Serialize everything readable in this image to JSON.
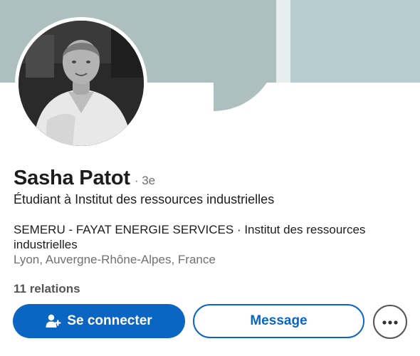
{
  "profile": {
    "name": "Sasha Patot",
    "degree": "· 3e",
    "headline": "Étudiant à Institut des ressources industrielles",
    "positions": "SEMERU - FAYAT ENERGIE SERVICES · Institut des ressources industrielles",
    "location": "Lyon, Auvergne-Rhône-Alpes, France",
    "connections": "11 relations"
  },
  "actions": {
    "connect_label": "Se connecter",
    "connect_icon": "add-person-icon",
    "message_label": "Message",
    "more_icon": "more-horizontal-icon"
  },
  "colors": {
    "primary": "#0a66c2",
    "text": "#1d1d1d",
    "muted": "#707070",
    "banner": "#aebfbf"
  }
}
